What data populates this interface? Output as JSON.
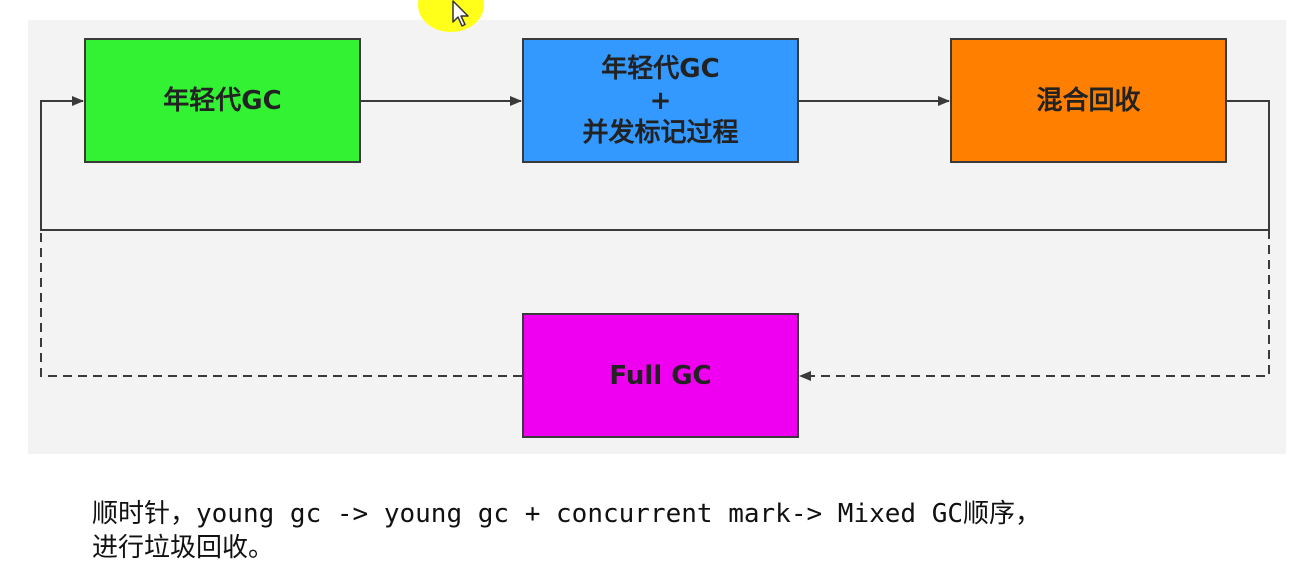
{
  "diagram": {
    "nodes": [
      {
        "id": "young",
        "lines": [
          "年轻代GC"
        ],
        "color": "#33f233"
      },
      {
        "id": "concurrent",
        "lines": [
          "年轻代GC",
          "+",
          "并发标记过程"
        ],
        "color": "#3399ff"
      },
      {
        "id": "mixed",
        "lines": [
          "混合回收"
        ],
        "color": "#ff8000"
      },
      {
        "id": "full",
        "lines": [
          "Full GC"
        ],
        "color": "#f000f0"
      }
    ],
    "line_color": "#3a3a3a"
  },
  "caption": {
    "line1": "顺时针，young gc -> young gc + concurrent mark-> Mixed GC顺序，",
    "line2": "进行垃圾回收。"
  }
}
